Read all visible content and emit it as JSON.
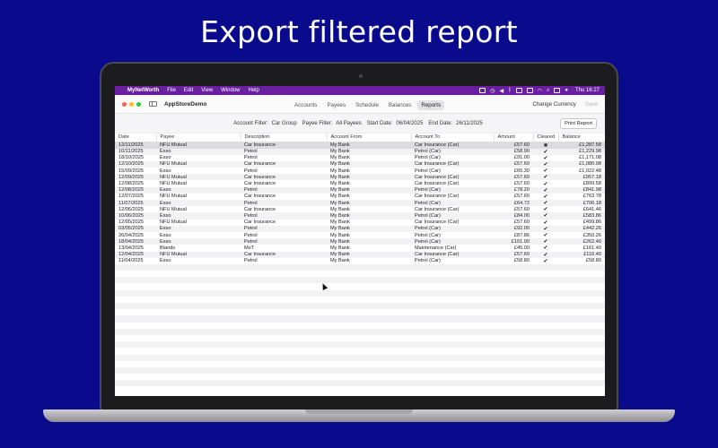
{
  "headline": "Export filtered report",
  "menubar": {
    "app_name": "MyNetWorth",
    "menus": [
      "File",
      "Edit",
      "View",
      "Window",
      "Help"
    ],
    "clock": "Thu 16:27"
  },
  "toolbar": {
    "title": "AppStoreDemo",
    "tabs": [
      "Accounts",
      "Payees",
      "Schedule",
      "Balances",
      "Reports"
    ],
    "active_tab": "Reports",
    "change_currency": "Change Currency",
    "save": "Save"
  },
  "filters": {
    "account_label": "Account Filter:",
    "account_value": "Car Group",
    "payee_label": "Payee Filter:",
    "payee_value": "All Payees",
    "start_label": "Start Date:",
    "start_value": "06/04/2025",
    "end_label": "End Date:",
    "end_value": "26/11/2025",
    "print_button": "Print Report"
  },
  "table": {
    "columns": [
      "Date",
      "Payee",
      "Description",
      "Account From",
      "Account To",
      "Amount",
      "Cleared",
      "Balance"
    ],
    "rows": [
      [
        "12/11/2025",
        "NFU Mutual",
        "Car Insurance",
        "My Bank",
        "Car Insurance (Car)",
        "£57.60",
        "✖",
        "£1,287.58"
      ],
      [
        "10/11/2025",
        "Esso",
        "Petrol",
        "My Bank",
        "Petrol (Car)",
        "£58.90",
        "✔",
        "£1,229.98"
      ],
      [
        "18/10/2025",
        "Esso",
        "Petrol",
        "My Bank",
        "Petrol (Car)",
        "£91.00",
        "✔",
        "£1,171.08"
      ],
      [
        "12/10/2025",
        "NFU Mutual",
        "Car Insurance",
        "My Bank",
        "Car Insurance (Car)",
        "£57.60",
        "✔",
        "£1,080.08"
      ],
      [
        "15/09/2025",
        "Esso",
        "Petrol",
        "My Bank",
        "Petrol (Car)",
        "£65.30",
        "✔",
        "£1,022.48"
      ],
      [
        "12/09/2025",
        "NFU Mutual",
        "Car Insurance",
        "My Bank",
        "Car Insurance (Car)",
        "£57.60",
        "✔",
        "£957.18"
      ],
      [
        "12/08/2025",
        "NFU Mutual",
        "Car Insurance",
        "My Bank",
        "Car Insurance (Car)",
        "£57.60",
        "✔",
        "£899.58"
      ],
      [
        "12/08/2025",
        "Esso",
        "Petrol",
        "My Bank",
        "Petrol (Car)",
        "£78.20",
        "✔",
        "£841.98"
      ],
      [
        "12/07/2025",
        "NFU Mutual",
        "Car Insurance",
        "My Bank",
        "Car Insurance (Car)",
        "£57.60",
        "✔",
        "£763.78"
      ],
      [
        "11/07/2025",
        "Esso",
        "Petrol",
        "My Bank",
        "Petrol (Car)",
        "£64.72",
        "✔",
        "£706.18"
      ],
      [
        "12/06/2025",
        "NFU Mutual",
        "Car Insurance",
        "My Bank",
        "Car Insurance (Car)",
        "£57.60",
        "✔",
        "£641.46"
      ],
      [
        "10/06/2025",
        "Esso",
        "Petrol",
        "My Bank",
        "Petrol (Car)",
        "£84.00",
        "✔",
        "£583.86"
      ],
      [
        "12/05/2025",
        "NFU Mutual",
        "Car Insurance",
        "My Bank",
        "Car Insurance (Car)",
        "£57.60",
        "✔",
        "£499.86"
      ],
      [
        "03/05/2025",
        "Esso",
        "Petrol",
        "My Bank",
        "Petrol (Car)",
        "£92.00",
        "✔",
        "£442.26"
      ],
      [
        "26/04/2025",
        "Esso",
        "Petrol",
        "My Bank",
        "Petrol (Car)",
        "£87.86",
        "✔",
        "£350.26"
      ],
      [
        "18/04/2025",
        "Esso",
        "Petrol",
        "My Bank",
        "Petrol (Car)",
        "£101.00",
        "✔",
        "£262.40"
      ],
      [
        "13/04/2025",
        "Blands",
        "MoT",
        "My Bank",
        "Maintenance (Car)",
        "£45.00",
        "✔",
        "£161.40"
      ],
      [
        "12/04/2025",
        "NFU Mutual",
        "Car Insurance",
        "My Bank",
        "Car Insurance (Car)",
        "£57.60",
        "✔",
        "£116.40"
      ],
      [
        "11/04/2025",
        "Esso",
        "Petrol",
        "My Bank",
        "Petrol (Car)",
        "£58.80",
        "✔",
        "£58.80"
      ]
    ]
  },
  "colors": {
    "background": "#0a0a8c",
    "menubar": "#6a1fa0",
    "close": "#ff5f57",
    "minimize": "#febc2e",
    "zoom": "#28c840"
  }
}
